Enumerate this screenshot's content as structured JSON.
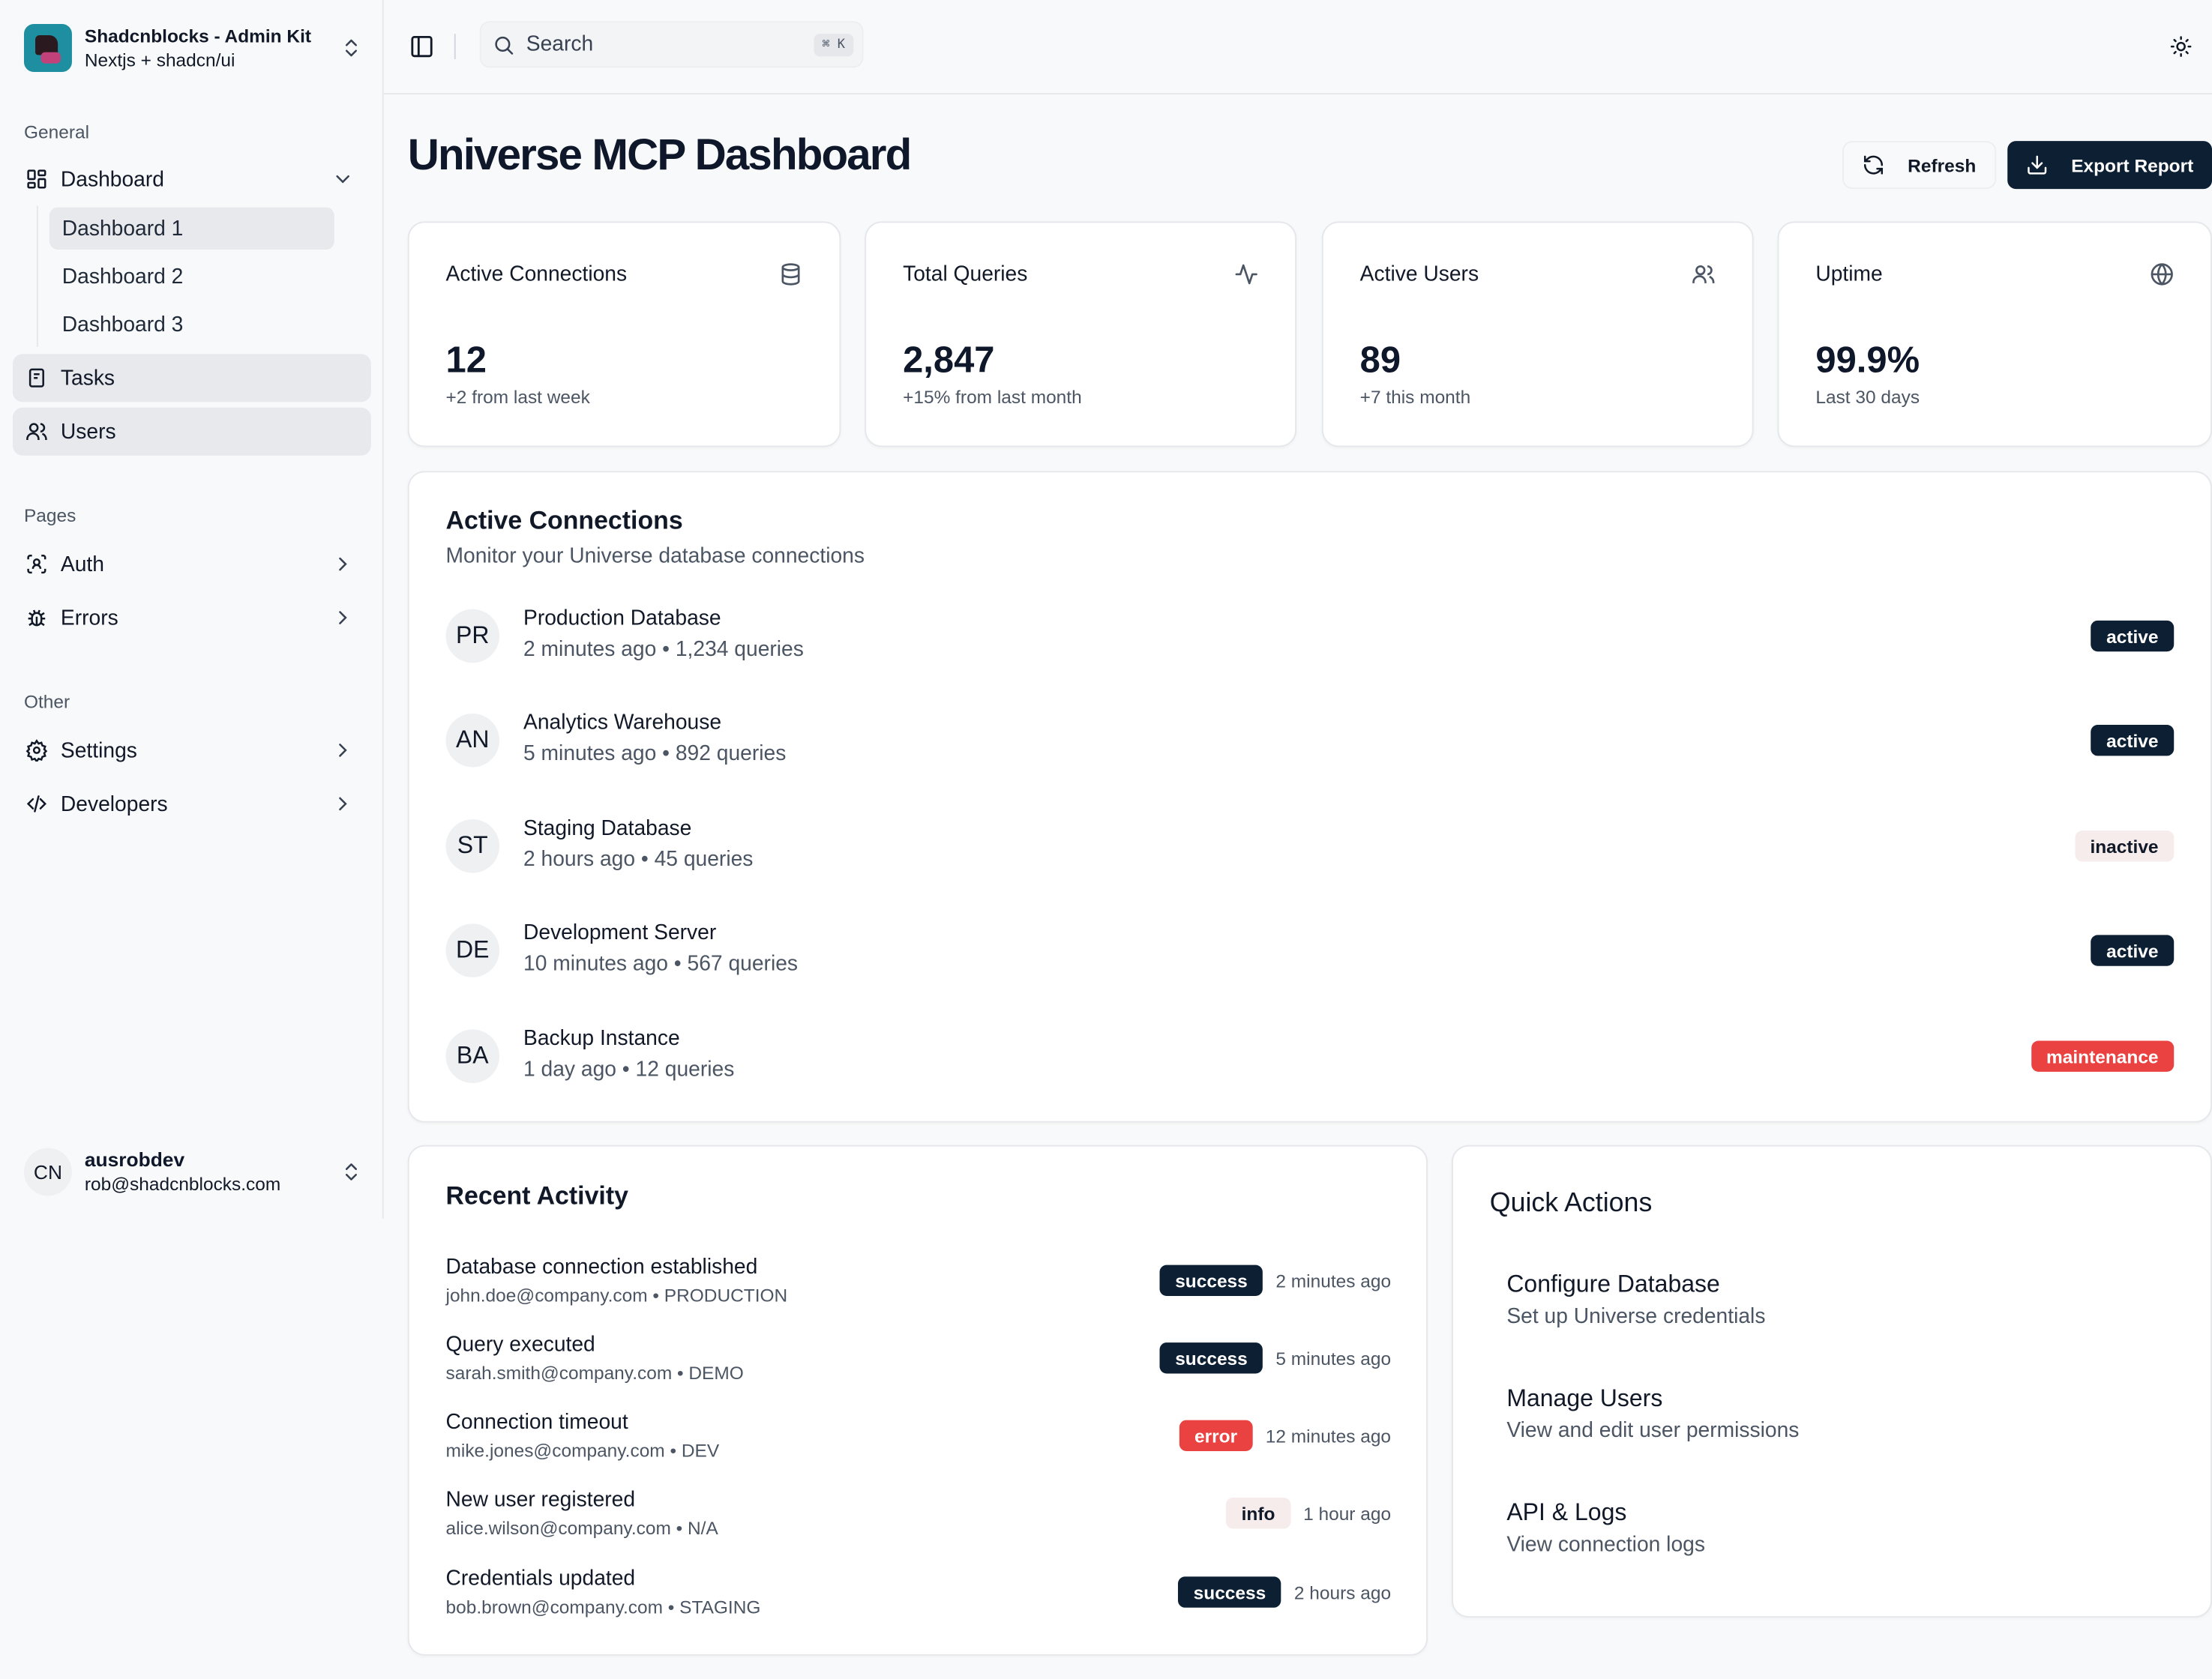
{
  "brand": {
    "name": "Shadcnblocks - Admin Kit",
    "subtitle": "Nextjs + shadcn/ui"
  },
  "sidebar": {
    "general_label": "General",
    "dashboard": {
      "label": "Dashboard",
      "subitems": [
        "Dashboard 1",
        "Dashboard 2",
        "Dashboard 3"
      ]
    },
    "tasks": "Tasks",
    "users": "Users",
    "pages_label": "Pages",
    "auth": "Auth",
    "errors": "Errors",
    "other_label": "Other",
    "settings": "Settings",
    "developers": "Developers"
  },
  "user": {
    "initials": "CN",
    "name": "ausrobdev",
    "email": "rob@shadcnblocks.com"
  },
  "topbar": {
    "search_placeholder": "Search",
    "shortcut": "⌘ K"
  },
  "page": {
    "title": "Universe MCP Dashboard",
    "refresh_label": "Refresh",
    "export_label": "Export Report"
  },
  "stats": [
    {
      "label": "Active Connections",
      "value": "12",
      "sub": "+2 from last week",
      "icon": "database-icon"
    },
    {
      "label": "Total Queries",
      "value": "2,847",
      "sub": "+15% from last month",
      "icon": "activity-icon"
    },
    {
      "label": "Active Users",
      "value": "89",
      "sub": "+7 this month",
      "icon": "users-icon"
    },
    {
      "label": "Uptime",
      "value": "99.9%",
      "sub": "Last 30 days",
      "icon": "globe-icon"
    }
  ],
  "connections": {
    "title": "Active Connections",
    "description": "Monitor your Universe database connections",
    "rows": [
      {
        "initials": "PR",
        "name": "Production Database",
        "meta": "2 minutes ago • 1,234 queries",
        "status": "active"
      },
      {
        "initials": "AN",
        "name": "Analytics Warehouse",
        "meta": "5 minutes ago • 892 queries",
        "status": "active"
      },
      {
        "initials": "ST",
        "name": "Staging Database",
        "meta": "2 hours ago • 45 queries",
        "status": "inactive"
      },
      {
        "initials": "DE",
        "name": "Development Server",
        "meta": "10 minutes ago • 567 queries",
        "status": "active"
      },
      {
        "initials": "BA",
        "name": "Backup Instance",
        "meta": "1 day ago • 12 queries",
        "status": "maintenance"
      }
    ]
  },
  "activity": {
    "title": "Recent Activity",
    "rows": [
      {
        "title": "Database connection established",
        "meta": "john.doe@company.com • PRODUCTION",
        "status": "success",
        "time": "2 minutes ago"
      },
      {
        "title": "Query executed",
        "meta": "sarah.smith@company.com • DEMO",
        "status": "success",
        "time": "5 minutes ago"
      },
      {
        "title": "Connection timeout",
        "meta": "mike.jones@company.com • DEV",
        "status": "error",
        "time": "12 minutes ago"
      },
      {
        "title": "New user registered",
        "meta": "alice.wilson@company.com • N/A",
        "status": "info",
        "time": "1 hour ago"
      },
      {
        "title": "Credentials updated",
        "meta": "bob.brown@company.com • STAGING",
        "status": "success",
        "time": "2 hours ago"
      }
    ]
  },
  "quick_actions": {
    "title": "Quick Actions",
    "items": [
      {
        "title": "Configure Database",
        "desc": "Set up Universe credentials"
      },
      {
        "title": "Manage Users",
        "desc": "View and edit user permissions"
      },
      {
        "title": "API & Logs",
        "desc": "View connection logs"
      }
    ]
  },
  "colors": {
    "primary": "#0c1f33",
    "danger": "#ea4141",
    "muted_badge": "#f5eceb",
    "sidebar_active": "#e7e9ec",
    "brand_logo": "#1e8fa0"
  }
}
